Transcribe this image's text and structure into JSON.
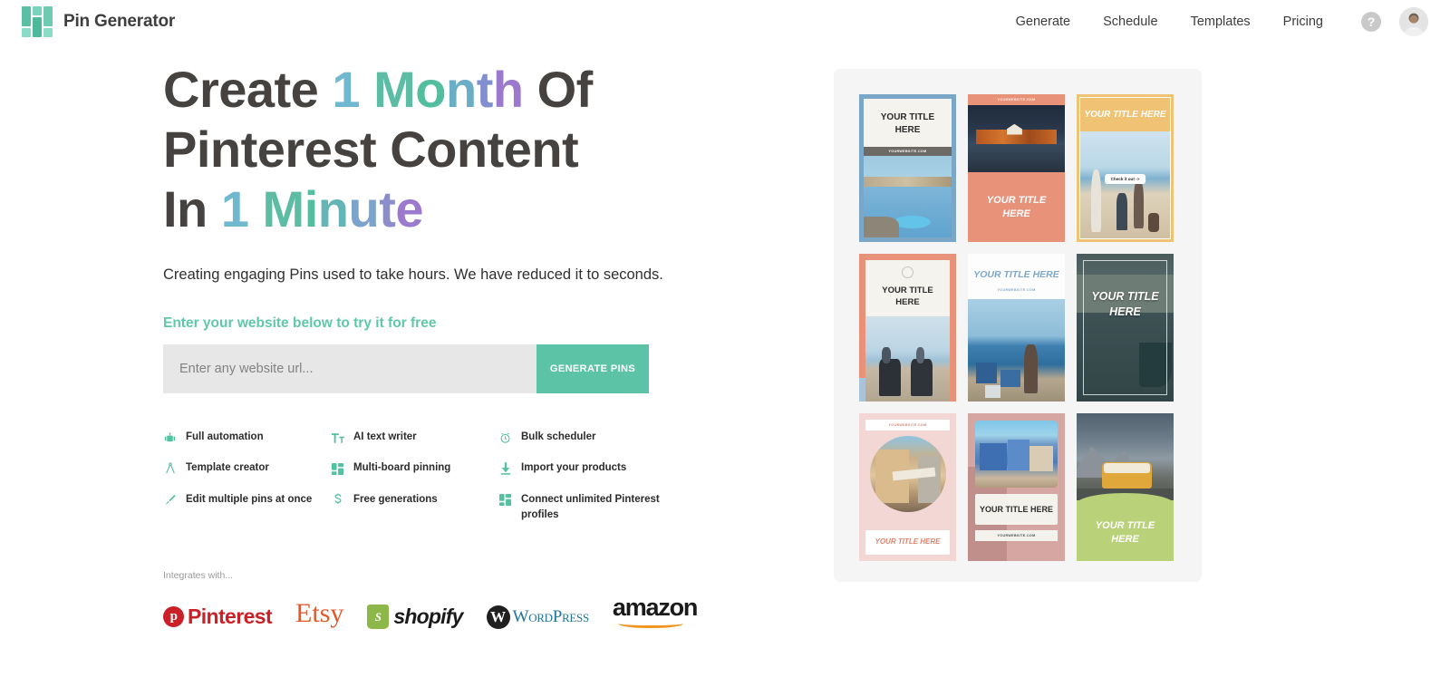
{
  "header": {
    "brand_name": "Pin Generator",
    "logo_icon": "grid-logo-icon",
    "nav": [
      {
        "label": "Generate"
      },
      {
        "label": "Schedule"
      },
      {
        "label": "Templates"
      },
      {
        "label": "Pricing"
      }
    ],
    "help_label": "?",
    "help_icon": "question-mark-icon",
    "avatar_icon": "user-avatar-icon"
  },
  "hero": {
    "headline_lines": [
      [
        {
          "text": "Create ",
          "color": "#45423f"
        },
        {
          "text": "1",
          "color": "#6fb8cf"
        },
        {
          "text": " ",
          "color": "#45423f"
        },
        {
          "text": "M",
          "color": "#5cbda4"
        },
        {
          "text": "o",
          "color": "#53be9f"
        },
        {
          "text": "n",
          "color": "#6aaec6"
        },
        {
          "text": "t",
          "color": "#7f8fcf"
        },
        {
          "text": "h",
          "color": "#9b79cc"
        },
        {
          "text": " Of",
          "color": "#45423f"
        }
      ],
      [
        {
          "text": "Pinterest Content",
          "color": "#45423f"
        }
      ],
      [
        {
          "text": "In ",
          "color": "#45423f"
        },
        {
          "text": "1",
          "color": "#6fb8cf"
        },
        {
          "text": " ",
          "color": "#45423f"
        },
        {
          "text": "M",
          "color": "#5cbda4"
        },
        {
          "text": "i",
          "color": "#55bda0"
        },
        {
          "text": "n",
          "color": "#63b5b7"
        },
        {
          "text": "u",
          "color": "#7ba3cb"
        },
        {
          "text": "t",
          "color": "#8c8ecc"
        },
        {
          "text": "e",
          "color": "#9b79cc"
        }
      ]
    ],
    "subtitle": "Creating engaging Pins used to take hours. We have reduced it to seconds.",
    "cta_label": "Enter your website below to try it for free",
    "accent_color": "#5fc8a9"
  },
  "form": {
    "input_placeholder": "Enter any website url...",
    "input_value": "",
    "button_label": "GENERATE PINS"
  },
  "features": [
    {
      "icon": "robot-icon",
      "label": "Full automation"
    },
    {
      "icon": "text-tool-icon",
      "label": "AI text writer"
    },
    {
      "icon": "alarm-clock-icon",
      "label": "Bulk scheduler"
    },
    {
      "icon": "compass-icon",
      "label": "Template creator"
    },
    {
      "icon": "grid-icon",
      "label": "Multi-board pinning"
    },
    {
      "icon": "download-icon",
      "label": "Import your products"
    },
    {
      "icon": "paintbrush-icon",
      "label": "Edit multiple pins at once"
    },
    {
      "icon": "dollar-icon",
      "label": "Free generations"
    },
    {
      "icon": "grid-icon",
      "label": "Connect unlimited Pinterest profiles"
    }
  ],
  "integrations": {
    "label": "Integrates with...",
    "logos": [
      {
        "name": "pinterest-logo",
        "text": "Pinterest",
        "mark": "p",
        "color": "#cb2027"
      },
      {
        "name": "etsy-logo",
        "text": "Etsy",
        "color": "#e2592a"
      },
      {
        "name": "shopify-logo",
        "text": "shopify",
        "mark": "S",
        "color": "#8db849"
      },
      {
        "name": "wordpress-logo",
        "text": "WordPress",
        "mark": "W",
        "color": "#21759b"
      },
      {
        "name": "amazon-logo",
        "text": "amazon",
        "color": "#f0951f"
      }
    ]
  },
  "showcase": {
    "pins": [
      {
        "id": "pin-1",
        "title": "YOUR TITLE HERE",
        "url": "YOURWEBSITE.COM",
        "style": "blue-frame-lake"
      },
      {
        "id": "pin-2",
        "title": "YOUR TITLE HERE",
        "url": "YOURWEBSITE.COM",
        "style": "coral-town"
      },
      {
        "id": "pin-3",
        "title": "YOUR TITLE HERE",
        "badge": "Check it out ->",
        "style": "yellow-beach"
      },
      {
        "id": "pin-4",
        "title": "YOUR TITLE HERE",
        "style": "coral-motorbikes"
      },
      {
        "id": "pin-5",
        "title": "YOUR TITLE HERE",
        "url": "YOURWEBSITE.COM",
        "style": "white-blue-dock"
      },
      {
        "id": "pin-6",
        "title": "YOUR TITLE HERE",
        "style": "dark-boat"
      },
      {
        "id": "pin-7",
        "title": "YOUR TITLE HERE",
        "url": "YOURWEBSITE.COM",
        "style": "pink-circle-street"
      },
      {
        "id": "pin-8",
        "title": "YOUR TITLE HERE",
        "url": "YOURWEBSITE.COM",
        "style": "mauve-bluecity"
      },
      {
        "id": "pin-9",
        "title": "YOUR TITLE HERE",
        "style": "green-van"
      }
    ]
  }
}
